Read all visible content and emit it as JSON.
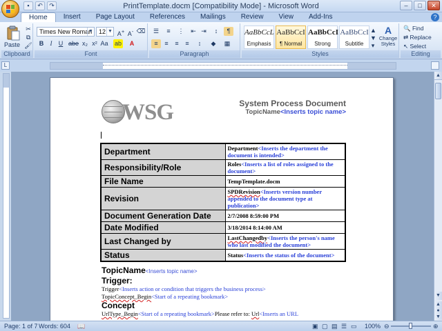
{
  "window": {
    "title": "PrintTemplate.docm [Compatibility Mode] - Microsoft Word",
    "controls": [
      "–",
      "□",
      "✕"
    ]
  },
  "ribbon_tabs": [
    "Home",
    "Insert",
    "Page Layout",
    "References",
    "Mailings",
    "Review",
    "View",
    "Add-Ins"
  ],
  "ribbon": {
    "clipboard": {
      "paste": "Paste",
      "label": "Clipboard"
    },
    "font": {
      "name": "Times New Roman",
      "size": "12",
      "label": "Font"
    },
    "paragraph": {
      "label": "Paragraph"
    },
    "styles": {
      "label": "Styles",
      "items": [
        {
          "sample": "AaBbCcL",
          "name": "Emphasis"
        },
        {
          "sample": "AaBbCcI",
          "name": "¶ Normal"
        },
        {
          "sample": "AaBbCcI",
          "name": "Strong"
        },
        {
          "sample": "AaBbCcI",
          "name": "Subtitle"
        }
      ],
      "change_styles": "Change Styles"
    },
    "editing": {
      "label": "Editing",
      "find": "Find",
      "replace": "Replace",
      "select": "Select"
    }
  },
  "document": {
    "logo_text": "WSG",
    "heading": "System Process Document",
    "topic_prefix": "TopicName",
    "topic_placeholder": "<Inserts topic name>",
    "table": [
      {
        "label": "Department",
        "field": "Department",
        "placeholder": "<Inserts the department the document is intended>"
      },
      {
        "label": "Responsibility/Role",
        "field": "Roles",
        "placeholder": "<Inserts a list of roles assigned to the document>"
      },
      {
        "label": "File Name",
        "field": "TempTemplate.docm",
        "placeholder": ""
      },
      {
        "label": "Revision",
        "field": "SPDRevision",
        "placeholder": "<Inserts version number appended to the document type at publication>"
      },
      {
        "label": "Document Generation Date",
        "field": "2/7/2008 8:59:00 PM",
        "placeholder": ""
      },
      {
        "label": "Date Modified",
        "field": "3/18/2014 8:14:00 AM",
        "placeholder": ""
      },
      {
        "label": "Last Changed by",
        "field": "LastChangedby",
        "placeholder": "<Inserts the person's name who last modified the document>"
      },
      {
        "label": "Status",
        "field": "Status",
        "placeholder": "<Inserts the status of the document>"
      }
    ],
    "body": {
      "topic_heading": "TopicName",
      "topic_placeholder": "<Inserts topic name>",
      "trigger_heading": "Trigger:",
      "trigger_field": "Trigger",
      "trigger_placeholder": "<Inserts action or condition that triggers the business process>",
      "concept_begin": "TopicConcept_Begin",
      "concept_begin_placeholder": "<Start of a repeating bookmark>",
      "concept_heading": "Concept",
      "url_begin": "UrlType_Begin",
      "url_begin_placeholder": "<Start of a repeating bookmark>",
      "url_refer": "Please refer to: ",
      "url_field": "Url",
      "url_placeholder": "<Inserts an URL"
    }
  },
  "status_bar": {
    "page": "Page: 1 of 7",
    "words": "Words: 604",
    "zoom": "100%"
  }
}
